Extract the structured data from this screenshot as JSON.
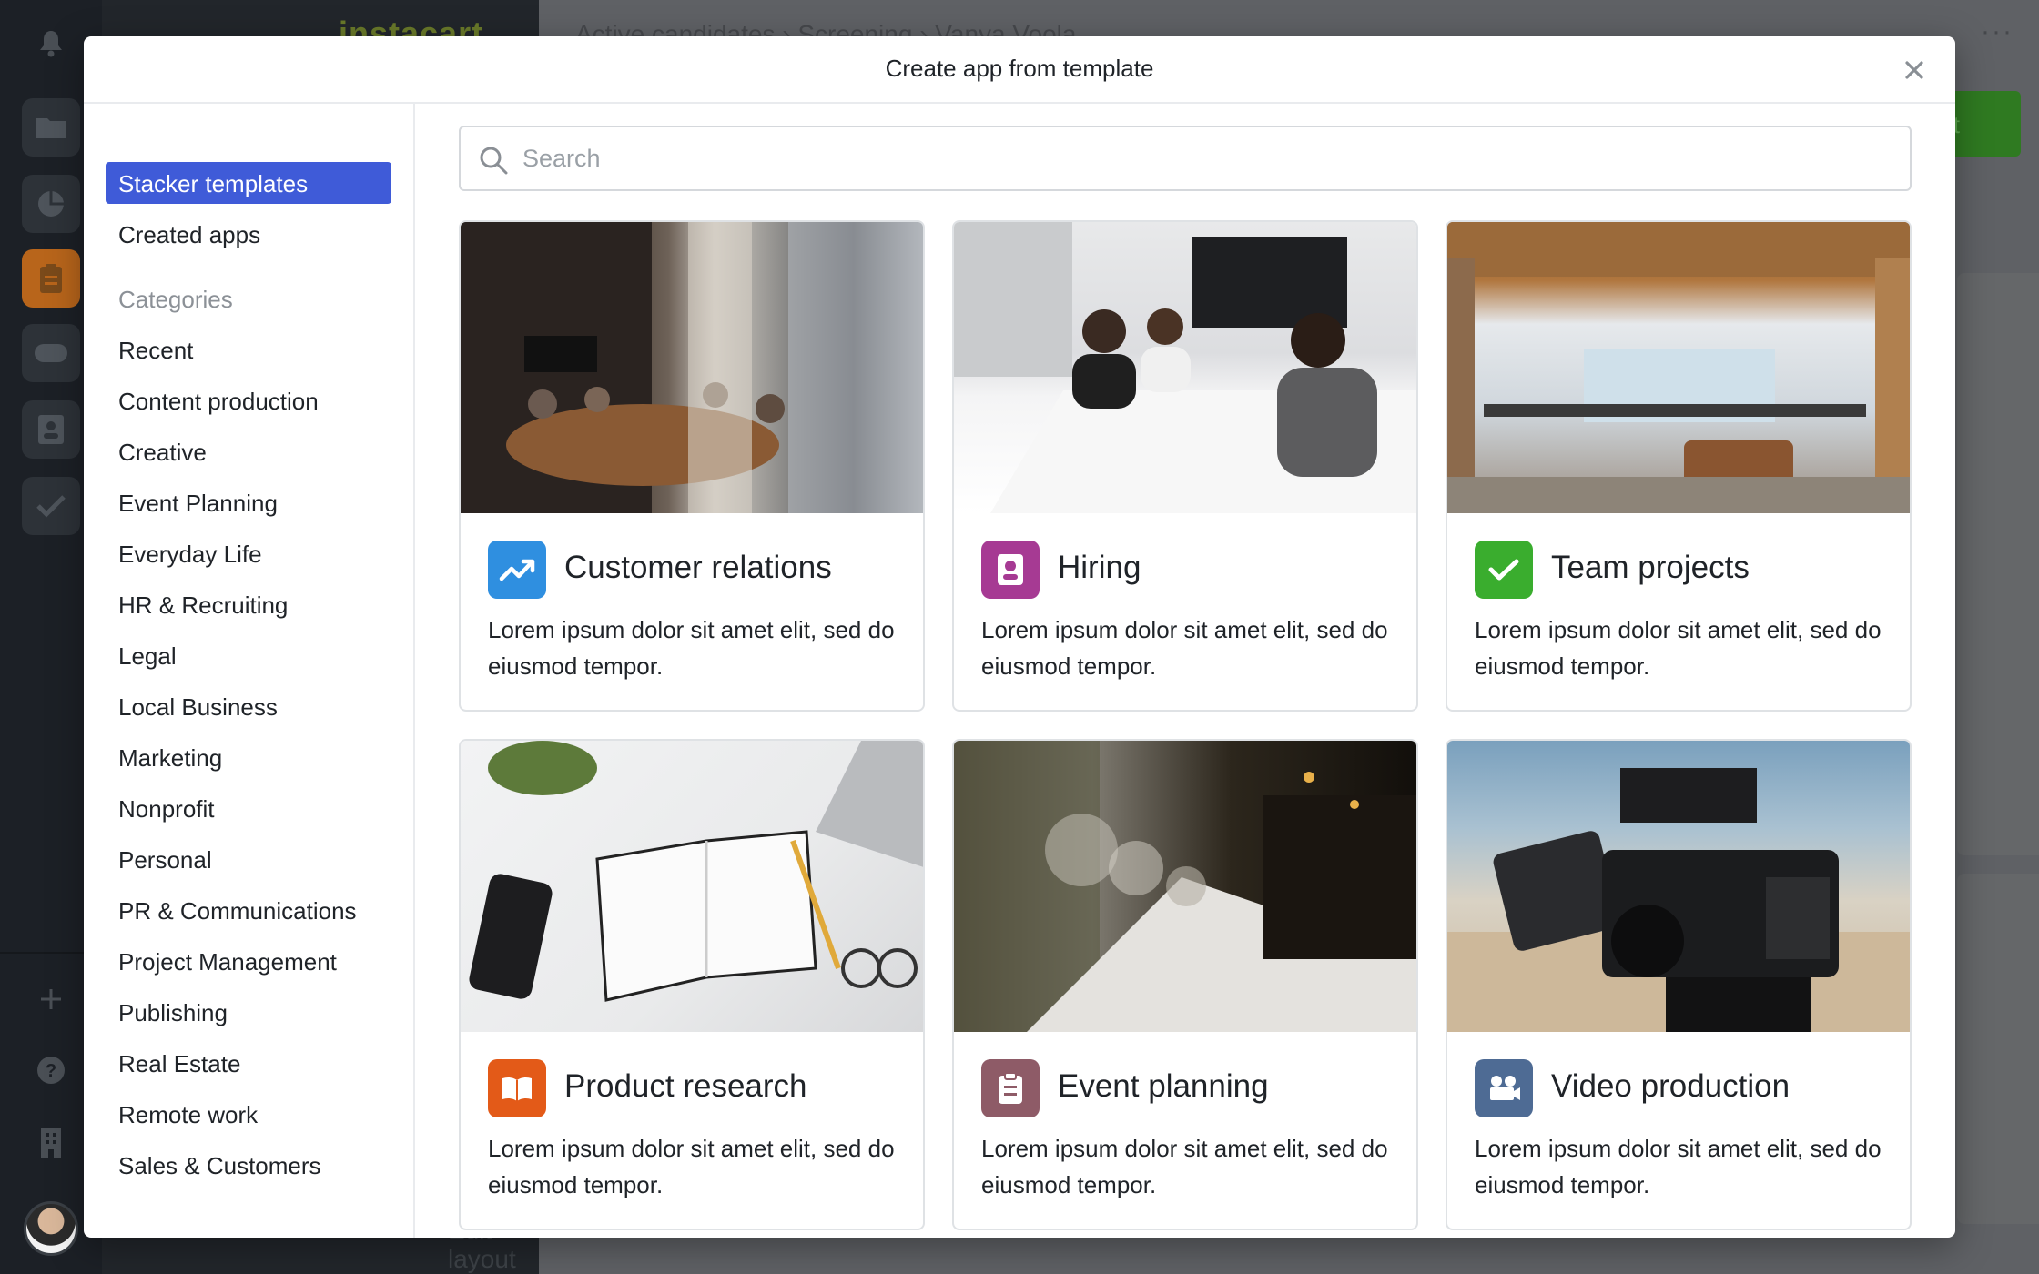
{
  "background": {
    "app_logo": "instacart",
    "breadcrumb": "Active candidates  ›  Screening  ›  Vanya Voola",
    "primary_button_label": "it",
    "bottom_text": "Edit layout"
  },
  "modal": {
    "title": "Create app from template",
    "close_label": "×"
  },
  "sidebar": {
    "tabs": [
      {
        "label": "Stacker templates",
        "active": true
      },
      {
        "label": "Created apps",
        "active": false
      }
    ],
    "categories_heading": "Categories",
    "categories": [
      "Recent",
      "Content production",
      "Creative",
      "Event Planning",
      "Everyday Life",
      "HR & Recruiting",
      "Legal",
      "Local Business",
      "Marketing",
      "Nonprofit",
      "Personal",
      "PR & Communications",
      "Project Management",
      "Publishing",
      "Real Estate",
      "Remote work",
      "Sales & Customers"
    ]
  },
  "search": {
    "placeholder": "Search",
    "value": ""
  },
  "templates": [
    {
      "title": "Customer relations",
      "description": "Lorem ipsum dolor sit amet elit, sed do eiusmod tempor.",
      "icon": "trend-up-icon",
      "color": "#2f8fe0"
    },
    {
      "title": "Hiring",
      "description": "Lorem ipsum dolor sit amet elit, sed do eiusmod tempor.",
      "icon": "contact-card-icon",
      "color": "#a63a93"
    },
    {
      "title": "Team projects",
      "description": "Lorem ipsum dolor sit amet elit, sed do eiusmod tempor.",
      "icon": "checkmark-icon",
      "color": "#3aad2e"
    },
    {
      "title": "Product research",
      "description": "Lorem ipsum dolor sit amet elit, sed do eiusmod tempor.",
      "icon": "open-book-icon",
      "color": "#e35a18"
    },
    {
      "title": "Event planning",
      "description": "Lorem ipsum dolor sit amet elit, sed do eiusmod tempor.",
      "icon": "clipboard-icon",
      "color": "#8e5b67"
    },
    {
      "title": "Video production",
      "description": "Lorem ipsum dolor sit amet elit, sed do eiusmod tempor.",
      "icon": "video-camera-icon",
      "color": "#4e6b94"
    }
  ],
  "colors": {
    "accent": "#3f5bd8",
    "border": "#dfe2e5"
  }
}
